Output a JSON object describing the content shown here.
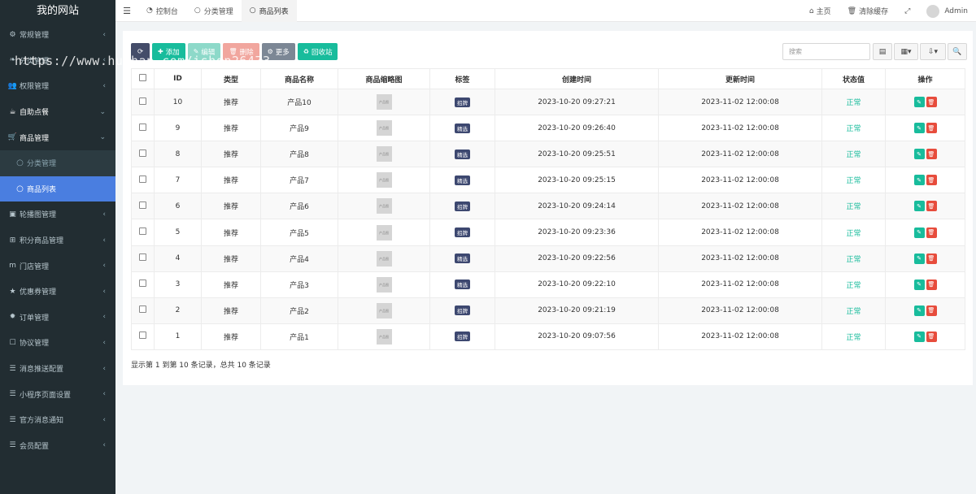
{
  "app": {
    "brand": "我的网站",
    "watermark": "https://www.huzhan.com/ishop26473"
  },
  "sidebar": {
    "items": [
      {
        "icon": "gears-icon",
        "glyph": "⚙",
        "label": "常规管理",
        "arrow": "‹"
      },
      {
        "icon": "leaf-icon",
        "glyph": "❧",
        "label": "分类管理",
        "arrow": "‹"
      },
      {
        "icon": "group-icon",
        "glyph": "👥",
        "label": "权限管理",
        "arrow": "‹"
      },
      {
        "icon": "coffee-icon",
        "glyph": "☕",
        "label": "自助点餐",
        "arrow": "⌄",
        "open": true
      },
      {
        "icon": "cart-icon",
        "glyph": "🛒",
        "label": "商品管理",
        "arrow": "⌄",
        "open": true
      },
      {
        "icon": "circle-icon",
        "glyph": "○",
        "label": "分类管理",
        "sub": true
      },
      {
        "icon": "circle-icon",
        "glyph": "○",
        "label": "商品列表",
        "sub": true,
        "active": true
      },
      {
        "icon": "image-icon",
        "glyph": "▣",
        "label": "轮播图管理",
        "arrow": "‹"
      },
      {
        "icon": "gift-icon",
        "glyph": "⊞",
        "label": "积分商品管理",
        "arrow": "‹"
      },
      {
        "icon": "shop-icon",
        "glyph": "m",
        "label": "门店管理",
        "arrow": "‹"
      },
      {
        "icon": "star-icon",
        "glyph": "★",
        "label": "优惠券管理",
        "arrow": "‹"
      },
      {
        "icon": "order-icon",
        "glyph": "✹",
        "label": "订单管理",
        "arrow": "‹"
      },
      {
        "icon": "doc-icon",
        "glyph": "☐",
        "label": "协议管理",
        "arrow": "‹"
      },
      {
        "icon": "list-icon",
        "glyph": "☰",
        "label": "消息推送配置",
        "arrow": "‹"
      },
      {
        "icon": "list-icon",
        "glyph": "☰",
        "label": "小程序页面设置",
        "arrow": "‹"
      },
      {
        "icon": "list-icon",
        "glyph": "☰",
        "label": "官方消息通知",
        "arrow": "‹"
      },
      {
        "icon": "list-icon",
        "glyph": "☰",
        "label": "会员配置",
        "arrow": "‹"
      }
    ]
  },
  "topbar": {
    "tabs": [
      {
        "icon": "dashboard-icon",
        "glyph": "◔",
        "label": "控制台"
      },
      {
        "icon": "circle-icon",
        "glyph": "○",
        "label": "分类管理"
      },
      {
        "icon": "circle-icon",
        "glyph": "○",
        "label": "商品列表",
        "active": true
      }
    ],
    "home": "主页",
    "clear_cache": "清除缓存",
    "user": "Admin"
  },
  "toolbar": {
    "add": "添加",
    "edit": "编辑",
    "delete": "删除",
    "more": "更多",
    "recycle": "回收站",
    "search_placeholder": "搜索"
  },
  "table": {
    "headers": [
      "",
      "ID",
      "类型",
      "商品名称",
      "商品缩略图",
      "标签",
      "创建时间",
      "更新时间",
      "状态值",
      "操作"
    ],
    "thumb_text": "产品图",
    "rows": [
      {
        "id": "10",
        "type": "推荐",
        "name": "产品10",
        "tag": "招牌",
        "created": "2023-10-20 09:27:21",
        "updated": "2023-11-02 12:00:08",
        "status": "正常"
      },
      {
        "id": "9",
        "type": "推荐",
        "name": "产品9",
        "tag": "精选",
        "created": "2023-10-20 09:26:40",
        "updated": "2023-11-02 12:00:08",
        "status": "正常"
      },
      {
        "id": "8",
        "type": "推荐",
        "name": "产品8",
        "tag": "精选",
        "created": "2023-10-20 09:25:51",
        "updated": "2023-11-02 12:00:08",
        "status": "正常"
      },
      {
        "id": "7",
        "type": "推荐",
        "name": "产品7",
        "tag": "精选",
        "created": "2023-10-20 09:25:15",
        "updated": "2023-11-02 12:00:08",
        "status": "正常"
      },
      {
        "id": "6",
        "type": "推荐",
        "name": "产品6",
        "tag": "招牌",
        "created": "2023-10-20 09:24:14",
        "updated": "2023-11-02 12:00:08",
        "status": "正常"
      },
      {
        "id": "5",
        "type": "推荐",
        "name": "产品5",
        "tag": "招牌",
        "created": "2023-10-20 09:23:36",
        "updated": "2023-11-02 12:00:08",
        "status": "正常"
      },
      {
        "id": "4",
        "type": "推荐",
        "name": "产品4",
        "tag": "精选",
        "created": "2023-10-20 09:22:56",
        "updated": "2023-11-02 12:00:08",
        "status": "正常"
      },
      {
        "id": "3",
        "type": "推荐",
        "name": "产品3",
        "tag": "精选",
        "created": "2023-10-20 09:22:10",
        "updated": "2023-11-02 12:00:08",
        "status": "正常"
      },
      {
        "id": "2",
        "type": "推荐",
        "name": "产品2",
        "tag": "招牌",
        "created": "2023-10-20 09:21:19",
        "updated": "2023-11-02 12:00:08",
        "status": "正常"
      },
      {
        "id": "1",
        "type": "推荐",
        "name": "产品1",
        "tag": "招牌",
        "created": "2023-10-20 09:07:56",
        "updated": "2023-11-02 12:00:08",
        "status": "正常"
      }
    ]
  },
  "pagination": {
    "summary": "显示第 1 到第 10 条记录，总共 10 条记录"
  }
}
